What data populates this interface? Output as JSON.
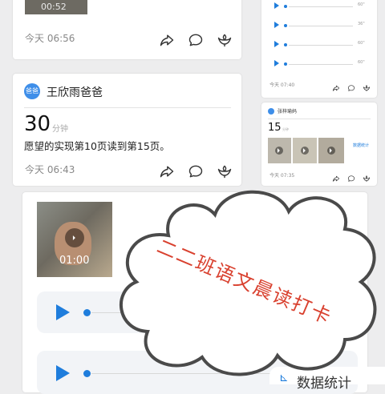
{
  "top_card": {
    "video_duration": "00:52",
    "timestamp": "今天 06:56"
  },
  "post": {
    "avatar_text": "爸爸",
    "username": "王欣雨爸爸",
    "minutes": "30",
    "minutes_unit": "分钟",
    "content": "愿望的实现第10页读到第15页。",
    "timestamp": "今天 06:43"
  },
  "right_top_card": {
    "audio_durations": [
      "60\"",
      "36\"",
      "60\"",
      "60\""
    ],
    "timestamp": "今天 07:40"
  },
  "right_post": {
    "username": "张梓瑜妈",
    "minutes": "15",
    "minutes_unit": "分钟",
    "stats_label": "数据统计",
    "timestamp": "今天 07:35"
  },
  "bottom_card": {
    "video_duration": "01:00",
    "stats_label": "数据统计"
  },
  "overlay": {
    "text": "二二班语文晨读打卡",
    "text_color": "#d9412f"
  },
  "colors": {
    "accent": "#1f7ddc",
    "avatar": "#3e8ee9"
  }
}
